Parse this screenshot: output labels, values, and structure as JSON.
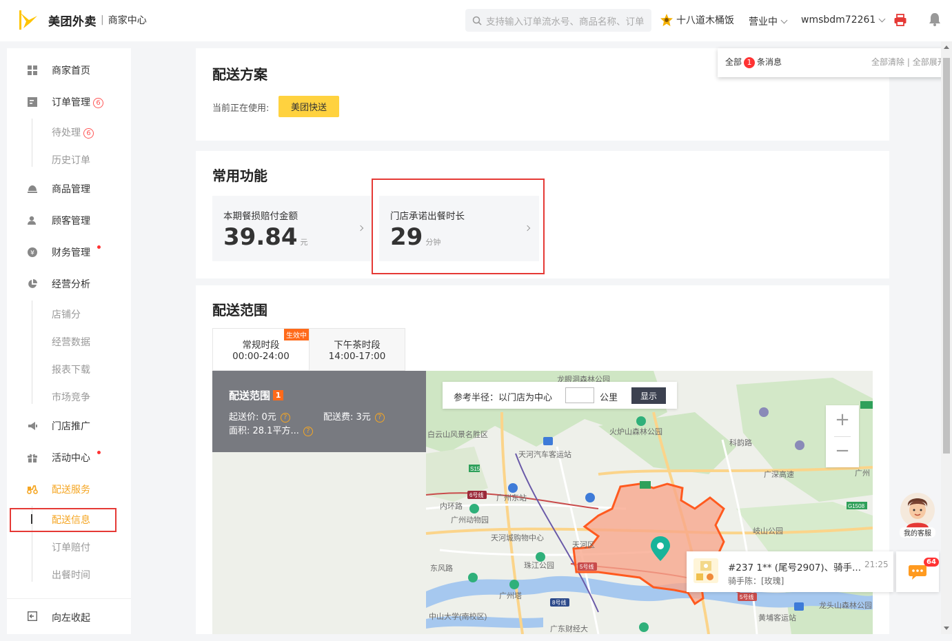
{
  "header": {
    "logo_text": "美团外卖",
    "logo_sep": "|",
    "logo_sub": "商家中心",
    "search_placeholder": "支持输入订单流水号、商品名称、订单",
    "store_name": "十八道木桶饭",
    "status": "营业中",
    "account": "wmsbdm72261"
  },
  "sidebar": {
    "items": [
      {
        "label": "商家首页",
        "icon": "grid-icon"
      },
      {
        "label": "订单管理",
        "badge": "6",
        "icon": "order-icon"
      },
      {
        "label": "待处理",
        "badge": "6"
      },
      {
        "label": "历史订单"
      },
      {
        "label": "商品管理",
        "icon": "dish-icon"
      },
      {
        "label": "顾客管理",
        "icon": "user-icon"
      },
      {
        "label": "财务管理",
        "icon": "yen-icon"
      },
      {
        "label": "经营分析",
        "icon": "pie-icon"
      },
      {
        "label": "店铺分"
      },
      {
        "label": "经营数据"
      },
      {
        "label": "报表下载"
      },
      {
        "label": "市场竞争"
      },
      {
        "label": "门店推广",
        "icon": "megaphone-icon"
      },
      {
        "label": "活动中心",
        "icon": "gift-icon"
      },
      {
        "label": "配送服务",
        "icon": "scooter-icon"
      },
      {
        "label": "配送信息"
      },
      {
        "label": "订单赔付"
      },
      {
        "label": "出餐时间"
      },
      {
        "label": "向左收起",
        "icon": "collapse-icon"
      }
    ]
  },
  "delivery_plan": {
    "title": "配送方案",
    "current_label": "当前正在使用:",
    "current_value": "美团快送"
  },
  "common": {
    "title": "常用功能",
    "cards": [
      {
        "label": "本期餐损赔付金额",
        "value": "39.84",
        "unit": "元"
      },
      {
        "label": "门店承诺出餐时长",
        "value": "29",
        "unit": "分钟"
      }
    ]
  },
  "range": {
    "title": "配送范围",
    "tabs": [
      {
        "name": "常规时段",
        "time": "00:00-24:00",
        "badge": "生效中"
      },
      {
        "name": "下午茶时段",
        "time": "14:00-17:00"
      }
    ],
    "panel_title": "配送范围",
    "panel_count": "1",
    "min_price": "起送价: 0元",
    "fee": "配送费: 3元",
    "area": "面积: 28.1平方...",
    "radius_label": "参考半径：以门店为中心",
    "radius_unit": "公里",
    "radius_button": "显示"
  },
  "map_labels": [
    "龙眼洞森林公园",
    "白云山风景名胜区",
    "火炉山森林公园",
    "天河汽车客运站",
    "广州东站",
    "广州动物园",
    "天河城购物中心",
    "珠江公园",
    "广州塔",
    "中山大学(南校区)",
    "岐山公园",
    "龙头山森林公园",
    "黄埔客运站",
    "广深高速",
    "内环路",
    "东风路",
    "天河区",
    "广州",
    "科韵路",
    "6号线",
    "5号线",
    "8号线",
    "S15",
    "G1508",
    "广东财经大"
  ],
  "messages": {
    "all_label": "全部",
    "count": "1",
    "suffix": "条消息",
    "clear": "全部清除",
    "sep": "|",
    "expand": "全部展开"
  },
  "order": {
    "title": "#237  1** (尾号2907)、骑手...",
    "time": "21:25",
    "rider": "骑手陈：[玫瑰]"
  },
  "chat": {
    "badge": "64"
  },
  "service": {
    "label": "我的客服"
  },
  "colors": {
    "accent": "#ffd23f",
    "active": "#f5a623",
    "highlight": "#e53935",
    "range_fill": "#f9a58a",
    "range_stroke": "#ff5a1f"
  }
}
